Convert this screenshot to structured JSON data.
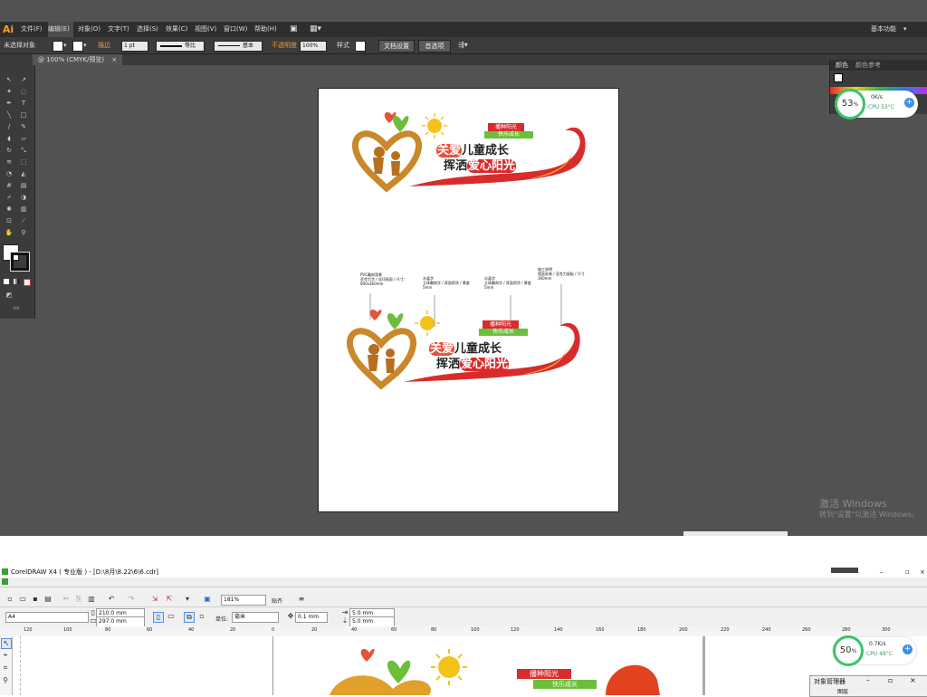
{
  "illustrator": {
    "logo": "Ai",
    "menus": [
      "文件(F)",
      "编辑(E)",
      "对象(O)",
      "文字(T)",
      "选择(S)",
      "效果(C)",
      "视图(V)",
      "窗口(W)",
      "帮助(H)"
    ],
    "active_menu": "编辑(E)",
    "workspace": "基本功能",
    "control_bar": {
      "selection": "未选择对象",
      "stroke_label": "描边",
      "stroke_weight": "1 pt",
      "profile_1": "等比",
      "profile_2": "基本",
      "opacity_label": "不透明度",
      "opacity_value": "100%",
      "style_label": "样式",
      "doc_setup": "文档设置",
      "preferences": "首选项"
    },
    "doc_tab": "@ 100% (CMYK/预览)",
    "panel_tabs": [
      "颜色",
      "颜色参考"
    ]
  },
  "artwork": {
    "tag_top": "播种阳光",
    "tag_bottom": "快乐成长",
    "line1_highlight": "关爱",
    "line1_rest": "儿童成长",
    "line2_start": "挥洒",
    "line2_highlight": "爱心阳光"
  },
  "annotations": [
    {
      "title": "PVC雕刻背景",
      "body": "亚克力字 / 丝印画面 / 尺寸：900x360mm"
    },
    {
      "title": "水晶字",
      "body": "立体雕刻字 / 背面喷涂 / 厚度5mm"
    },
    {
      "title": "水晶字",
      "body": "立体雕刻字 / 背面喷涂 / 厚度5mm"
    },
    {
      "title": "施工说明",
      "body": "墙面安装 / 亚克力面板 / 尺寸300mm"
    }
  ],
  "gauge_top": {
    "percent": "53",
    "unit": "%",
    "speed": "0K/s",
    "cpu": "CPU 53°C"
  },
  "gauge_bottom": {
    "percent": "50",
    "unit": "%",
    "speed": "0.7K/s",
    "cpu": "CPU 48°C"
  },
  "windows_watermark": {
    "line1": "激活 Windows",
    "line2": "转到\"设置\"以激活 Windows。"
  },
  "corel": {
    "title": "CorelDRAW X4 ( 专业版 ) - [D:\\8月\\8.22\\6\\6.cdr]",
    "zoom": "181%",
    "snap_label": "贴齐",
    "page_size": "A4",
    "width": "210.0 mm",
    "height": "297.0 mm",
    "units_label": "单位:",
    "units_value": "毫米",
    "nudge": "0.1 mm",
    "dup_x": "5.0 mm",
    "dup_y": "5.0 mm",
    "ruler_ticks": [
      "120",
      "100",
      "80",
      "60",
      "40",
      "20",
      "0",
      "20",
      "40",
      "60",
      "80",
      "100",
      "120",
      "140",
      "160",
      "180",
      "200",
      "220",
      "240",
      "260",
      "280",
      "300"
    ],
    "object_manager": "对象管理器",
    "object_manager_sub": "图层"
  },
  "colors": {
    "ai_bg": "#525252",
    "ai_menubar": "#2e2e2e",
    "ai_orange": "#f7a21b",
    "art_red": "#d92b2b",
    "art_gold": "#c9882b",
    "art_green": "#6bbf3a",
    "gauge_green": "#38c46b"
  },
  "icons": [
    "cursor-icon",
    "pen-icon",
    "type-icon",
    "brush-icon",
    "eyedropper-icon",
    "hand-icon",
    "zoom-icon",
    "fill-swatch-icon",
    "stroke-swatch-icon",
    "heart-icon",
    "sun-icon"
  ]
}
